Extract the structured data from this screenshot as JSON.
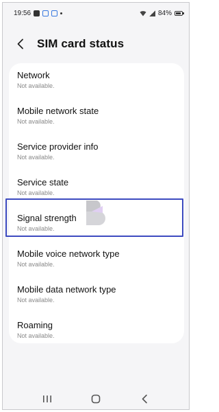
{
  "status_bar": {
    "time": "19:56",
    "battery": "84%"
  },
  "header": {
    "title": "SIM card status"
  },
  "items": [
    {
      "label": "Network",
      "value": "Not available."
    },
    {
      "label": "Mobile network state",
      "value": "Not available."
    },
    {
      "label": "Service provider info",
      "value": "Not available."
    },
    {
      "label": "Service state",
      "value": "Not available."
    },
    {
      "label": "Signal strength",
      "value": "Not available."
    },
    {
      "label": "Mobile voice network type",
      "value": "Not available."
    },
    {
      "label": "Mobile data network type",
      "value": "Not available."
    },
    {
      "label": "Roaming",
      "value": "Not available."
    }
  ],
  "highlighted_item": "Signal strength",
  "icons": {
    "back": "back-arrow-icon",
    "recents": "recents-icon",
    "home": "home-icon",
    "back_nav": "back-nav-icon"
  },
  "colors": {
    "highlight": "#3d4ac0",
    "background": "#f5f5f7"
  }
}
